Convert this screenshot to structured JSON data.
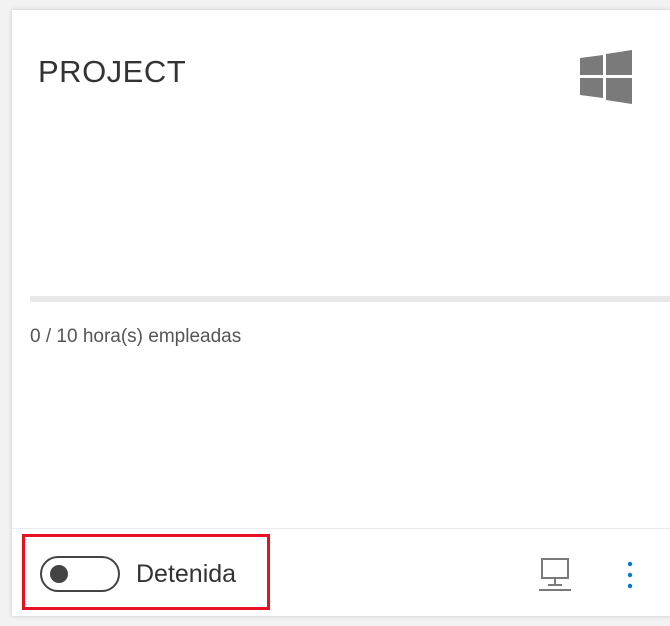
{
  "card": {
    "title": "PROJECT",
    "os_icon": "windows-logo-icon",
    "usage": {
      "text": "0 / 10 hora(s) empleadas",
      "used": 0,
      "total": 10
    },
    "footer": {
      "toggle_state": "off",
      "status_label": "Detenida",
      "connect_icon": "remote-desktop-icon",
      "more_icon": "more-vertical-icon"
    }
  },
  "colors": {
    "highlight": "#e81123",
    "accent": "#0078d4",
    "icon_gray": "#7a7a7a"
  }
}
